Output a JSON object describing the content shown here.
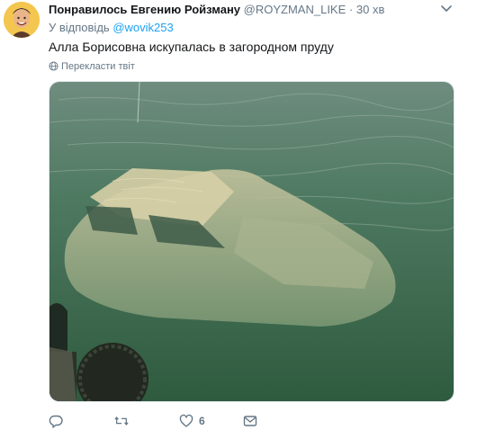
{
  "tweet": {
    "author": "Понравилось Евгению Ройзману",
    "handle": "@ROYZMAN_LIKE",
    "separator": "·",
    "time": "30 хв",
    "reply_prefix": "У відповідь",
    "reply_to": "@wovik253",
    "text": "Алла Борисовна искупалась в загородном пруду",
    "translate_label": "Перекласти твіт"
  },
  "actions": {
    "reply_count": "",
    "retweet_count": "",
    "like_count": "6"
  },
  "colors": {
    "link": "#1da1f2",
    "secondary": "#657786",
    "text": "#14171a"
  },
  "icons": [
    "chevron-down-icon",
    "globe-icon",
    "reply-icon",
    "retweet-icon",
    "heart-icon",
    "message-icon"
  ]
}
